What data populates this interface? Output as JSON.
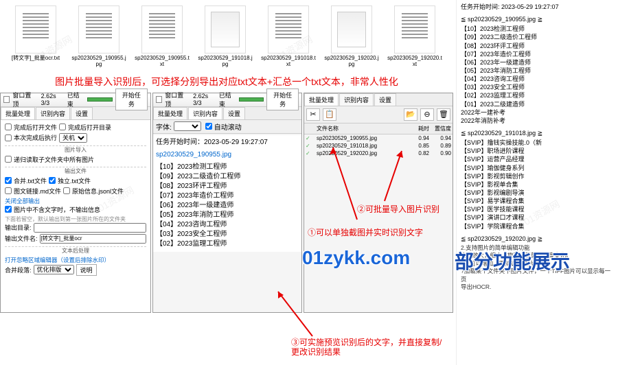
{
  "top_files": [
    {
      "label": "[转文字]_批量ocr.txt",
      "type": "doc"
    },
    {
      "label": "sp20230529_190955.jpg",
      "type": "doc"
    },
    {
      "label": "sp20230529_190955.txt",
      "type": "doc"
    },
    {
      "label": "sp20230529_191018.jpg",
      "type": "img"
    },
    {
      "label": "sp20230529_191018.txt",
      "type": "doc"
    },
    {
      "label": "sp20230529_192020.jpg",
      "type": "img"
    },
    {
      "label": "sp20230529_192020.txt",
      "type": "doc"
    }
  ],
  "red_banner": "图片批量导入识别后，可选择分别导出对应txt文本+汇总一个txt文本，非常人性化",
  "header": {
    "pin": "窗口置顶",
    "time_stat": "2.62s  3/3",
    "done": "已结束",
    "start": "开始任务"
  },
  "tabs": {
    "t1": "批量处理",
    "t2": "识别内容",
    "t3": "设置"
  },
  "panel1": {
    "opt1": "完成后打开文件",
    "opt2": "完成后打开目录",
    "opt3": "本次完成后执行",
    "sel_shutdown": "关机",
    "sec_import": "图片导入",
    "read_subfolders": "递归读取子文件夹中所有图片",
    "sec_output": "输出文件",
    "merge_txt": "合并.txt文件",
    "single_txt": "独立.txt文件",
    "md": "图文链接.md文件",
    "json": "原始信息.jsonl文件",
    "close_all": "关闭全部输出",
    "no_text_no_output": "图片中不含文字时，不输出信息",
    "hint_default": "下面若留空，默认输出到第一张图片所在的文件夹",
    "out_dir_label": "输出目录:",
    "out_file_label": "输出文件名:",
    "out_file_value": "[转文字]_批量ocr",
    "sec_post": "文本后处理",
    "open_editor": "打开忽略区域编辑器（设置后排除水印）",
    "merge_paragraph": "合并段落:",
    "merge_option": "优化排版",
    "detail": "说明"
  },
  "panel2": {
    "font_label": "字体:",
    "auto_scroll": "自动滚动",
    "start_time_label": "任务开始时间：",
    "start_time_value": "2023-05-29 19:27:07",
    "current_file": "sp20230529_190955.jpg",
    "results": [
      "【10】2023检测工程师",
      "【09】2023二级造价工程师",
      "【08】2023环评工程师",
      "【07】2023年造价工程师",
      "【06】2023年一级建造师",
      "【05】2023年消防工程师",
      "【04】2023咨询工程师",
      "【03】2023安全工程师",
      "【02】2023监理工程师"
    ]
  },
  "panel3": {
    "col_status": "",
    "col_name": "文件名称",
    "col_time": "耗时",
    "col_conf": "置信度",
    "rows": [
      {
        "name": "sp20230529_190955.jpg",
        "t": "0.94",
        "c": "0.94"
      },
      {
        "name": "sp20230529_191018.jpg",
        "t": "0.85",
        "c": "0.89"
      },
      {
        "name": "sp20230529_192020.jpg",
        "t": "0.82",
        "c": "0.90"
      }
    ],
    "icons": {
      "screenshot": "✂",
      "paste": "📋",
      "open": "📂",
      "clear": "⊖",
      "delete": "🗑"
    }
  },
  "annotations": {
    "a1": "①可以单独截图并实时识别文字",
    "a2": "②可批量导入图片识别",
    "a3": "③可实施预览识别后的文字，并直接复制/更改识别结果"
  },
  "watermark_site": "01zykk.com",
  "watermark_feature": "部分功能展示",
  "right": {
    "start_line": "任务开始时间: 2023-05-29 19:27:07",
    "file1_head": "≦ sp20230529_190955.jpg ≧",
    "file1_list": [
      "【10】2023检测工程师",
      "【09】2023二级造价工程师",
      "【08】2023环评工程师",
      "【07】2023年造价工程师",
      "【06】2023年一级建造师",
      "【05】2023年消防工程师",
      "【04】2023咨询工程师",
      "【03】2023安全工程师",
      "【02】2023监理工程师",
      "【01】2023二级建造师",
      "2022年一建补考",
      "2022年消防补考"
    ],
    "file2_head": "≦ sp20230529_191018.jpg ≧",
    "file2_list": [
      "【SVIP】撸钱实操技能.0（新",
      "【SVIP】职场进阶课程",
      "【SVIP】运营产品经理",
      "【SVIP】瑜伽健身系列",
      "【SVIP】影视剪辑创作",
      "【SVIP】影视单合集",
      "【SVIP】影视编剧导演",
      "【SVIP】易学课程合集",
      "【SVIP】医学技能课程",
      "【SVIP】演讲口才课程",
      "【SVIP】学院课程合集"
    ],
    "file3_head": "≦ sp20230529_192020.jpg ≧",
    "file3_list": [
      "2.支持图片的简单编辑功能",
      "  支持放大，缩小，旋转，裁剪，灰度变化。",
      "?也可以增加，删除选中图片",
      "?加载某个文件夹下图片文件，一个TIFF图片可以显示每一页",
      "  导出HOCR."
    ]
  }
}
